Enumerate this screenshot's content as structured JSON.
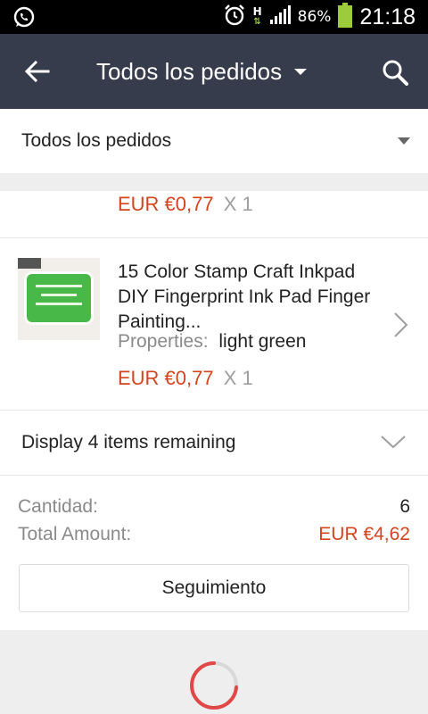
{
  "status_bar": {
    "battery": "86%",
    "time": "21:18",
    "network": "H",
    "icons": [
      "whatsapp-icon",
      "alarm-icon",
      "signal-icon",
      "battery-icon"
    ]
  },
  "app_bar": {
    "title": "Todos los pedidos",
    "icons": [
      "back-arrow-icon",
      "dropdown-caret-icon",
      "search-icon"
    ]
  },
  "filter": {
    "label": "Todos los pedidos"
  },
  "order": {
    "previous_item": {
      "price": "EUR €0,77",
      "qty": "X 1"
    },
    "item": {
      "title": "15 Color Stamp Craft Inkpad DIY Fingerprint Ink Pad Finger Painting...",
      "properties_label": "Properties:",
      "properties_value": "light green",
      "price": "EUR €0,77",
      "qty": "X 1"
    },
    "more_label": "Display 4 items remaining",
    "summary": {
      "quantity_label": "Cantidad:",
      "quantity_value": "6",
      "total_label": "Total Amount:",
      "total_value": "EUR €4,62"
    },
    "tracking_button": "Seguimiento"
  },
  "colors": {
    "app_bar": "#363c4c",
    "price": "#d2451e",
    "spinner": "#e04848"
  }
}
